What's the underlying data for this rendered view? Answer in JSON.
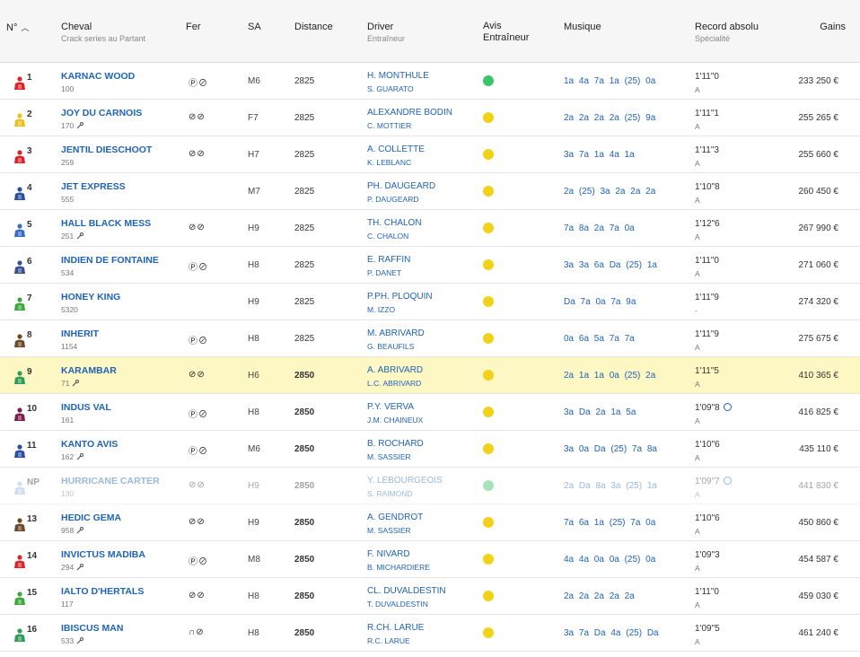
{
  "header": {
    "num": "N°",
    "cheval": "Cheval",
    "cheval_sub": "Crack series au Partant",
    "fer": "Fer",
    "sa": "SA",
    "distance": "Distance",
    "driver": "Driver",
    "driver_sub": "Entraîneur",
    "avis_line1": "Avis",
    "avis_line2": "Entraîneur",
    "musique": "Musique",
    "record": "Record absolu",
    "record_sub": "Spécialité",
    "gains": "Gains"
  },
  "colors": {
    "link": "#1f63b8",
    "highlight_row": "#fdf7c3",
    "avis_green": "#3cc46a",
    "avis_yellow": "#f2d11a"
  },
  "rows": [
    {
      "num": "1",
      "silk": "#d7262c",
      "name": "KARNAC WOOD",
      "sub": "100",
      "wrench": false,
      "fer": "Ⓟ⊘",
      "sa": "M6",
      "distance": "2825",
      "bold": false,
      "driver": "H. MONTHULE",
      "trainer": "S. GUARATO",
      "avis": "green",
      "musique": "1a 4a 7a 1a (25) 0a",
      "record": "1'11\"0",
      "clock": false,
      "spec": "A",
      "gains": "233 250 €",
      "highlight": false,
      "np": false
    },
    {
      "num": "2",
      "silk": "#e8c21c",
      "name": "JOY DU CARNOIS",
      "sub": "170",
      "wrench": true,
      "fer": "⊘⊘",
      "sa": "F7",
      "distance": "2825",
      "bold": false,
      "driver": "ALEXANDRE BODIN",
      "trainer": "C. MOTTIER",
      "avis": "yellow",
      "musique": "2a 2a 2a 2a (25) 9a",
      "record": "1'11\"1",
      "clock": false,
      "spec": "A",
      "gains": "255 265 €",
      "highlight": false,
      "np": false
    },
    {
      "num": "3",
      "silk": "#d7262c",
      "name": "JENTIL DIESCHOOT",
      "sub": "259",
      "wrench": false,
      "fer": "⊘⊘",
      "sa": "H7",
      "distance": "2825",
      "bold": false,
      "driver": "A. COLLETTE",
      "trainer": "K. LEBLANC",
      "avis": "yellow",
      "musique": "3a 7a 1a 4a 1a",
      "record": "1'11\"3",
      "clock": false,
      "spec": "A",
      "gains": "255 660 €",
      "highlight": false,
      "np": false
    },
    {
      "num": "4",
      "silk": "#2b4f9e",
      "name": "JET EXPRESS",
      "sub": "555",
      "wrench": false,
      "fer": "",
      "sa": "M7",
      "distance": "2825",
      "bold": false,
      "driver": "PH. DAUGEARD",
      "trainer": "P. DAUGEARD",
      "avis": "yellow",
      "musique": "2a (25) 3a 2a 2a 2a",
      "record": "1'10\"8",
      "clock": false,
      "spec": "A",
      "gains": "260 450 €",
      "highlight": false,
      "np": false
    },
    {
      "num": "5",
      "silk": "#3a6cc0",
      "name": "HALL BLACK MESS",
      "sub": "251",
      "wrench": true,
      "fer": "⊘⊘",
      "sa": "H9",
      "distance": "2825",
      "bold": false,
      "driver": "TH. CHALON",
      "trainer": "C. CHALON",
      "avis": "yellow",
      "musique": "7a 8a 2a 7a 0a",
      "record": "1'12\"6",
      "clock": false,
      "spec": "A",
      "gains": "267 990 €",
      "highlight": false,
      "np": false
    },
    {
      "num": "6",
      "silk": "#3a4f8e",
      "name": "INDIEN DE FONTAINE",
      "sub": "534",
      "wrench": false,
      "fer": "Ⓟ⊘",
      "sa": "H8",
      "distance": "2825",
      "bold": false,
      "driver": "E. RAFFIN",
      "trainer": "P. DANET",
      "avis": "yellow",
      "musique": "3a 3a 6a Da (25) 1a",
      "record": "1'11\"0",
      "clock": false,
      "spec": "A",
      "gains": "271 060 €",
      "highlight": false,
      "np": false
    },
    {
      "num": "7",
      "silk": "#3aa83a",
      "name": "HONEY KING",
      "sub": "5320",
      "wrench": false,
      "fer": "",
      "sa": "H9",
      "distance": "2825",
      "bold": false,
      "driver": "P.PH. PLOQUIN",
      "trainer": "M. IZZO",
      "avis": "yellow",
      "musique": "Da 7a 0a 7a 9a",
      "record": "1'11\"9",
      "clock": false,
      "spec": "-",
      "gains": "274 320 €",
      "highlight": false,
      "np": false
    },
    {
      "num": "8",
      "silk": "#6b4a2b",
      "name": "INHERIT",
      "sub": "1154",
      "wrench": false,
      "fer": "Ⓟ⊘",
      "sa": "H8",
      "distance": "2825",
      "bold": false,
      "driver": "M. ABRIVARD",
      "trainer": "G. BEAUFILS",
      "avis": "yellow",
      "musique": "0a 6a 5a 7a 7a",
      "record": "1'11\"9",
      "clock": false,
      "spec": "A",
      "gains": "275 675 €",
      "highlight": false,
      "np": false
    },
    {
      "num": "9",
      "silk": "#2f9b56",
      "name": "KARAMBAR",
      "sub": "71",
      "wrench": true,
      "fer": "⊘⊘",
      "sa": "H6",
      "distance": "2850",
      "bold": true,
      "driver": "A. ABRIVARD",
      "trainer": "L.C. ABRIVARD",
      "avis": "yellow",
      "musique": "2a 1a 1a 0a (25) 2a",
      "record": "1'11\"5",
      "clock": false,
      "spec": "A",
      "gains": "410 365 €",
      "highlight": true,
      "np": false
    },
    {
      "num": "10",
      "silk": "#7a1f4a",
      "name": "INDUS VAL",
      "sub": "161",
      "wrench": false,
      "fer": "Ⓟ⊘",
      "sa": "H8",
      "distance": "2850",
      "bold": true,
      "driver": "P.Y. VERVA",
      "trainer": "J.M. CHAINEUX",
      "avis": "yellow",
      "musique": "3a Da 2a 1a 5a",
      "record": "1'09\"8",
      "clock": true,
      "spec": "A",
      "gains": "416 825 €",
      "highlight": false,
      "np": false
    },
    {
      "num": "11",
      "silk": "#2b4f9e",
      "name": "KANTO AVIS",
      "sub": "162",
      "wrench": true,
      "fer": "Ⓟ⊘",
      "sa": "M6",
      "distance": "2850",
      "bold": true,
      "driver": "B. ROCHARD",
      "trainer": "M. SASSIER",
      "avis": "yellow",
      "musique": "3a 0a Da (25) 7a 8a",
      "record": "1'10\"6",
      "clock": false,
      "spec": "A",
      "gains": "435 110 €",
      "highlight": false,
      "np": false
    },
    {
      "num": "NP",
      "silk": "#9ab8d6",
      "name": "HURRICANE CARTER",
      "sub": "130",
      "wrench": false,
      "fer": "⊘⊘",
      "sa": "H9",
      "distance": "2850",
      "bold": true,
      "driver": "Y. LEBOURGEOIS",
      "trainer": "S. RAIMOND",
      "avis": "green",
      "musique": "2a Da 8a 3a (25) 1a",
      "record": "1'09\"7",
      "clock": true,
      "spec": "A",
      "gains": "441 830 €",
      "highlight": false,
      "np": true
    },
    {
      "num": "13",
      "silk": "#6b4a2b",
      "name": "HEDIC GEMA",
      "sub": "958",
      "wrench": true,
      "fer": "⊘⊘",
      "sa": "H9",
      "distance": "2850",
      "bold": true,
      "driver": "A. GENDROT",
      "trainer": "M. SASSIER",
      "avis": "yellow",
      "musique": "7a 6a 1a (25) 7a 0a",
      "record": "1'10\"6",
      "clock": false,
      "spec": "A",
      "gains": "450 860 €",
      "highlight": false,
      "np": false
    },
    {
      "num": "14",
      "silk": "#d7262c",
      "name": "INVICTUS MADIBA",
      "sub": "294",
      "wrench": true,
      "fer": "Ⓟ⊘",
      "sa": "M8",
      "distance": "2850",
      "bold": true,
      "driver": "F. NIVARD",
      "trainer": "B. MICHARDIERE",
      "avis": "yellow",
      "musique": "4a 4a 0a 0a (25) 0a",
      "record": "1'09\"3",
      "clock": false,
      "spec": "A",
      "gains": "454 587 €",
      "highlight": false,
      "np": false
    },
    {
      "num": "15",
      "silk": "#3aa83a",
      "name": "IALTO D'HERTALS",
      "sub": "117",
      "wrench": false,
      "fer": "⊘⊘",
      "sa": "H8",
      "distance": "2850",
      "bold": true,
      "driver": "CL. DUVALDESTIN",
      "trainer": "T. DUVALDESTIN",
      "avis": "yellow",
      "musique": "2a 2a 2a 2a 2a",
      "record": "1'11\"0",
      "clock": false,
      "spec": "A",
      "gains": "459 030 €",
      "highlight": false,
      "np": false
    },
    {
      "num": "16",
      "silk": "#2f9b56",
      "name": "IBISCUS MAN",
      "sub": "533",
      "wrench": true,
      "fer": "∩⊘",
      "sa": "H8",
      "distance": "2850",
      "bold": true,
      "driver": "R.CH. LARUE",
      "trainer": "R.C. LARUE",
      "avis": "yellow",
      "musique": "3a 7a Da 4a (25) Da",
      "record": "1'09\"5",
      "clock": false,
      "spec": "A",
      "gains": "461 240 €",
      "highlight": false,
      "np": false
    }
  ]
}
